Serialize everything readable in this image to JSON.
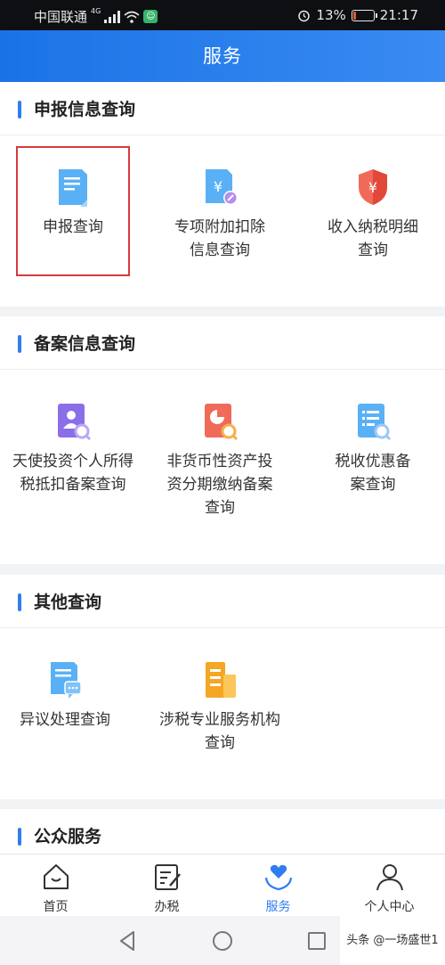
{
  "status_bar": {
    "carrier": "中国联通",
    "network": "4G",
    "battery": "13%",
    "battery_level": 0.13,
    "time": "21:17"
  },
  "header": {
    "title": "服务"
  },
  "sections": [
    {
      "title": "申报信息查询",
      "items": [
        {
          "label": "申报查询",
          "icon": "document-icon",
          "highlighted": true
        },
        {
          "label": "专项附加扣除信息查询",
          "icon": "yen-document-edit-icon"
        },
        {
          "label": "收入纳税明细查询",
          "icon": "yen-shield-icon"
        }
      ]
    },
    {
      "title": "备案信息查询",
      "items": [
        {
          "label": "天使投资个人所得税抵扣备案查询",
          "icon": "person-search-icon"
        },
        {
          "label": "非货币性资产投资分期缴纳备案查询",
          "icon": "pie-chart-search-icon"
        },
        {
          "label": "税收优惠备案查询",
          "icon": "list-search-icon"
        }
      ]
    },
    {
      "title": "其他查询",
      "items": [
        {
          "label": "异议处理查询",
          "icon": "document-chat-icon"
        },
        {
          "label": "涉税专业服务机构查询",
          "icon": "building-icon"
        }
      ]
    },
    {
      "title": "公众服务",
      "items": []
    }
  ],
  "tabbar": {
    "active": "服务",
    "tabs": [
      {
        "label": "首页",
        "icon": "home-icon"
      },
      {
        "label": "办税",
        "icon": "edit-document-icon"
      },
      {
        "label": "服务",
        "icon": "heart-hands-icon"
      },
      {
        "label": "个人中心",
        "icon": "user-icon"
      }
    ]
  },
  "nav": {
    "back": "back-icon",
    "home": "home-circle-icon",
    "recent": "recent-apps-icon"
  },
  "watermark": "头条 @一场盛世1",
  "colors": {
    "primary": "#2f7df0",
    "header_start": "#1a73e6",
    "highlight_border": "#d63b3b"
  }
}
